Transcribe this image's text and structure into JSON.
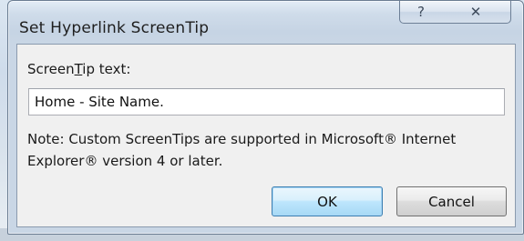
{
  "dialog": {
    "title": "Set Hyperlink ScreenTip",
    "help_glyph": "?",
    "close_glyph": "✕",
    "screentip_label_prefix": "Screen",
    "screentip_label_mnemonic": "T",
    "screentip_label_suffix": "ip text:",
    "screentip_value": "Home - Site Name.",
    "note_text": "Note: Custom ScreenTips are supported in Microsoft® Internet Explorer® version 4 or later.",
    "ok_label": "OK",
    "cancel_label": "Cancel"
  },
  "icons": {
    "help": "question-mark-icon",
    "close": "close-icon"
  }
}
